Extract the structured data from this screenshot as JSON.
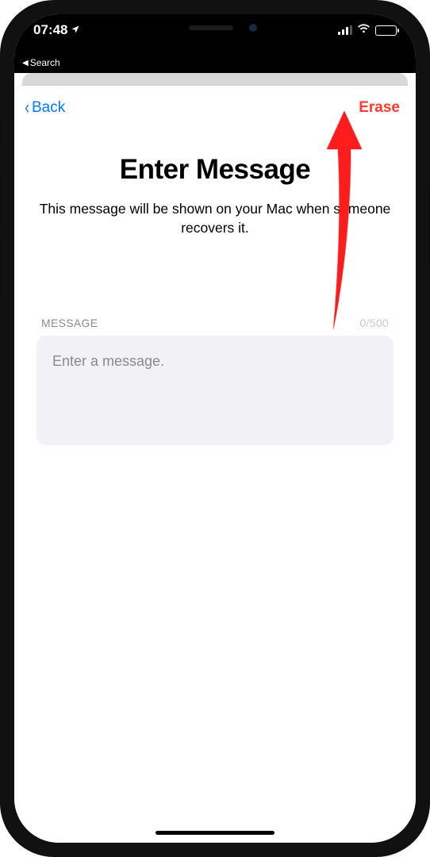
{
  "status": {
    "time": "07:48",
    "location_services": true,
    "breadcrumb_label": "Search"
  },
  "nav": {
    "back_label": "Back",
    "action_label": "Erase"
  },
  "header": {
    "title": "Enter Message",
    "subtitle": "This message will be shown on your Mac when someone recovers it."
  },
  "form": {
    "section_label": "MESSAGE",
    "char_count": "0/500",
    "placeholder": "Enter a message.",
    "value": ""
  },
  "colors": {
    "tint_blue": "#007aff",
    "destructive_red": "#ff3b30",
    "field_bg": "#f2f2f6",
    "secondary_text": "#8a8a8e"
  }
}
